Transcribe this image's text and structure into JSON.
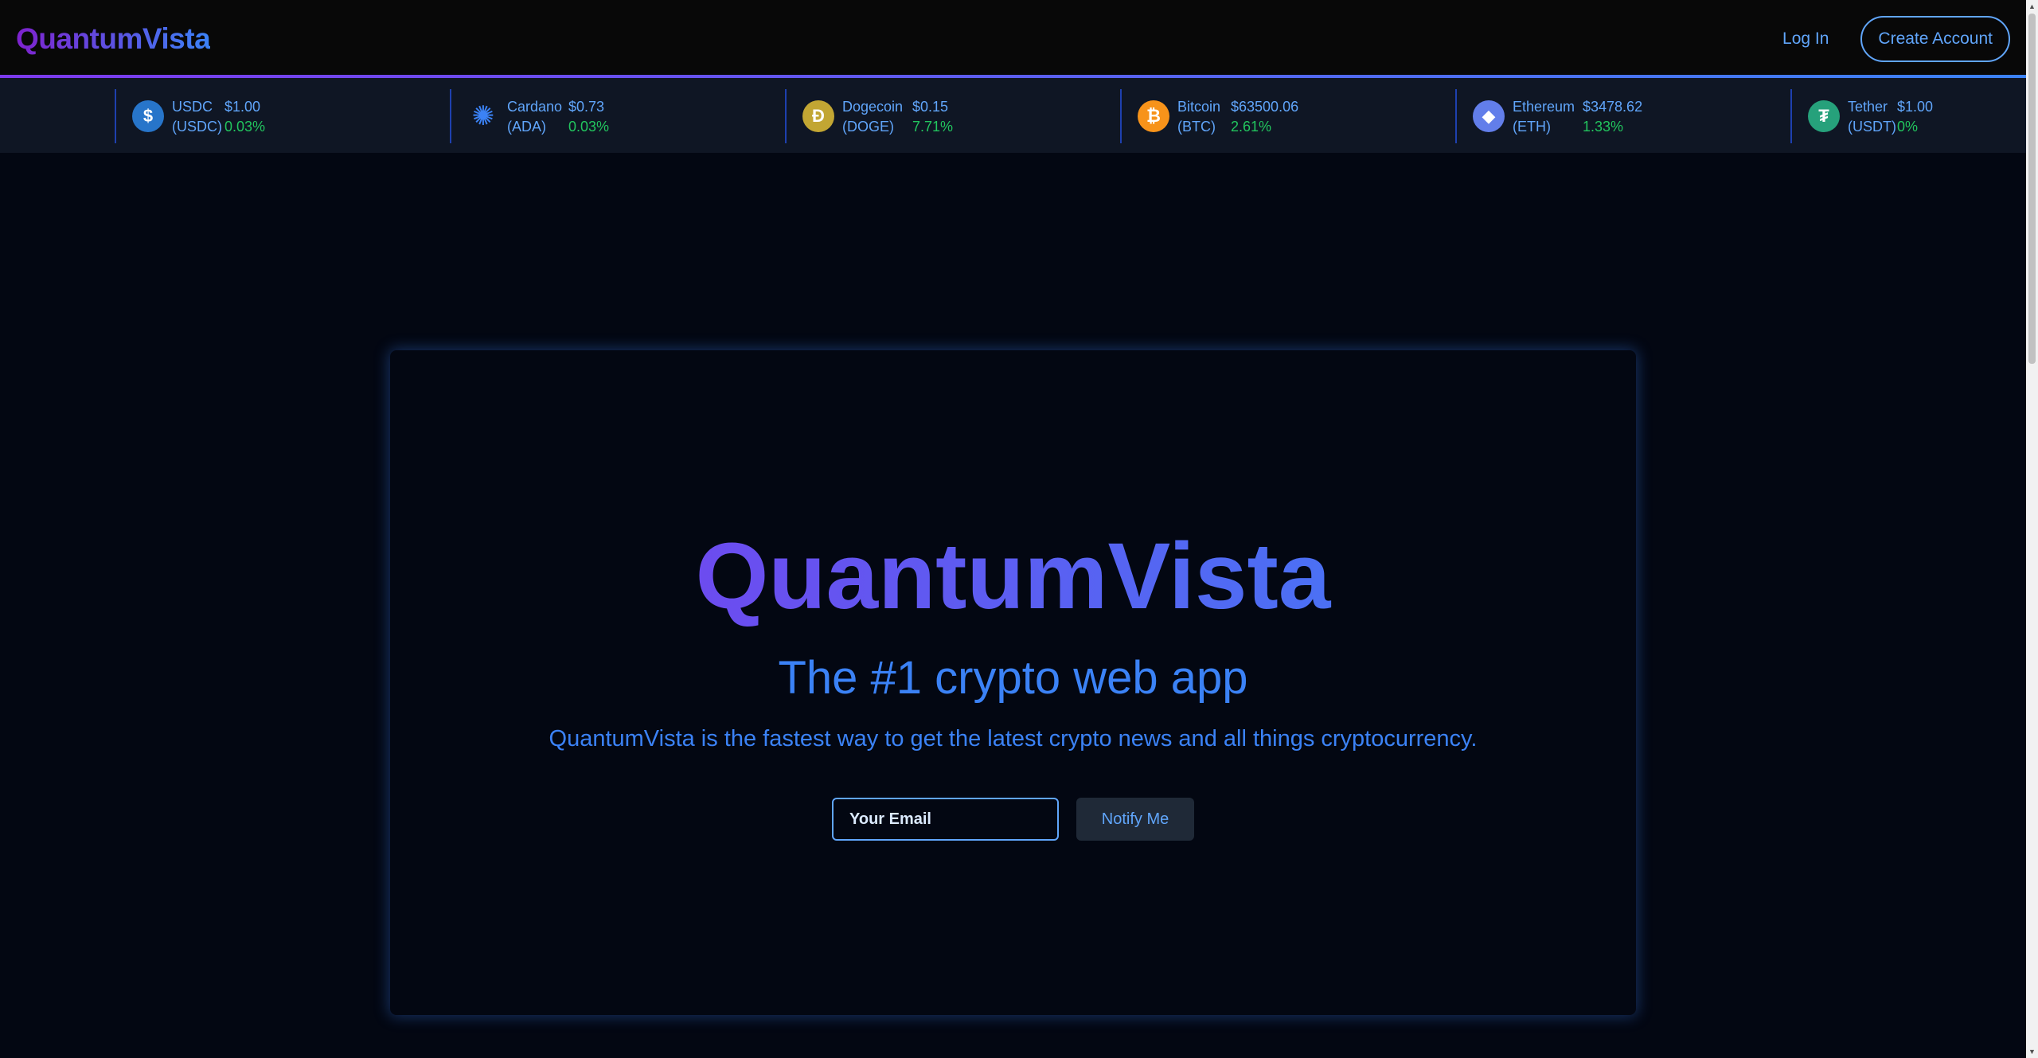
{
  "header": {
    "brand": "QuantumVista",
    "login_label": "Log In",
    "create_label": "Create Account"
  },
  "ticker": [
    {
      "name": "USDC",
      "symbol": "(USDC)",
      "price": "$1.00",
      "change": "0.03%",
      "icon": "usdc-icon",
      "color": "#2775ca",
      "glyph": "$"
    },
    {
      "name": "Cardano",
      "symbol": "(ADA)",
      "price": "$0.73",
      "change": "0.03%",
      "icon": "cardano-icon",
      "color": "#0033ad",
      "glyph": "✺"
    },
    {
      "name": "Dogecoin",
      "symbol": "(DOGE)",
      "price": "$0.15",
      "change": "7.71%",
      "icon": "dogecoin-icon",
      "color": "#c2a633",
      "glyph": "Ð"
    },
    {
      "name": "Bitcoin",
      "symbol": "(BTC)",
      "price": "$63500.06",
      "change": "2.61%",
      "icon": "bitcoin-icon",
      "color": "#f7931a",
      "glyph": "₿"
    },
    {
      "name": "Ethereum",
      "symbol": "(ETH)",
      "price": "$3478.62",
      "change": "1.33%",
      "icon": "ethereum-icon",
      "color": "#627eea",
      "glyph": "◆"
    },
    {
      "name": "Tether",
      "symbol": "(USDT)",
      "price": "$1.00",
      "change": "0%",
      "icon": "tether-icon",
      "color": "#26a17b",
      "glyph": "₮"
    }
  ],
  "hero": {
    "title": "QuantumVista",
    "tagline": "The #1 crypto web app",
    "subtitle": "QuantumVista is the fastest way to get the latest crypto news and all things cryptocurrency.",
    "email_placeholder": "Your Email",
    "notify_label": "Notify Me"
  },
  "colors": {
    "accent_blue": "#3b82f6",
    "accent_purple": "#7c3aed",
    "positive_green": "#22c55e",
    "background": "#030712"
  }
}
